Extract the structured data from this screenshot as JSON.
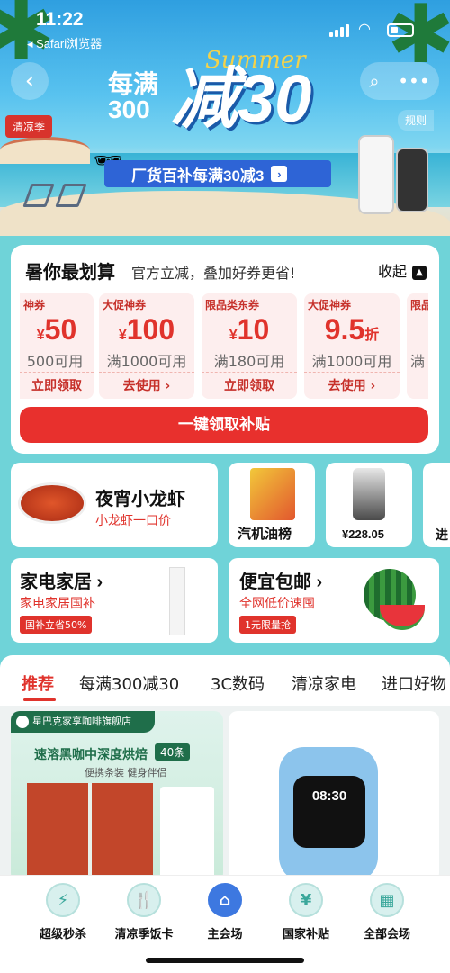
{
  "status": {
    "time": "11:22",
    "back_app": "◂ Safari浏览器"
  },
  "hero": {
    "summer": "Summer",
    "promo_prefix": "每满\n300",
    "promo_main": "减30",
    "season_tag": "清凉季",
    "rules": "规则",
    "banner": "厂货百补每满30减3",
    "banner_arrow": "›"
  },
  "coupon_panel": {
    "title": "暑你最划算",
    "subtitle": "官方立减，叠加好券更省!",
    "collapse": "收起",
    "coupons": [
      {
        "tag": "神券",
        "amount": "50",
        "prefix": "¥",
        "suffix": "",
        "cond": "500可用",
        "action": "立即领取"
      },
      {
        "tag": "大促神券",
        "amount": "100",
        "prefix": "¥",
        "suffix": "",
        "cond": "满1000可用",
        "action": "去使用 ›"
      },
      {
        "tag": "限品类东券",
        "amount": "10",
        "prefix": "¥",
        "suffix": "",
        "cond": "满180可用",
        "action": "立即领取"
      },
      {
        "tag": "大促神券",
        "amount": "9.5",
        "prefix": "",
        "suffix": "折",
        "cond": "满1000可用",
        "action": "去使用 ›"
      },
      {
        "tag": "限品",
        "amount": "",
        "prefix": "",
        "suffix": "",
        "cond": "满",
        "action": ""
      }
    ],
    "claim_all": "一键领取补贴"
  },
  "categories": {
    "crayfish": {
      "title": "夜宵小龙虾",
      "sub": "小龙虾一口价"
    },
    "oil": {
      "title": "汽机油榜"
    },
    "price": {
      "title": "¥228.05"
    },
    "more": {
      "title": "进"
    },
    "appliance": {
      "title": "家电家居 ›",
      "sub": "家电家居国补",
      "badge": "国补立省50%"
    },
    "cheap": {
      "title": "便宜包邮 ›",
      "sub": "全网低价速囤",
      "badge": "1元限量抢"
    }
  },
  "tabs": [
    "推荐",
    "每满300减30",
    "3C数码",
    "清凉家电",
    "进口好物"
  ],
  "feed": {
    "store": "星巴克家享咖啡旗舰店",
    "product_title": "速溶黑咖中深度烘焙",
    "count_badge": "40条",
    "product_sub": "便携条装 健身伴侣",
    "watch_time": "08:30"
  },
  "bottom_nav": [
    {
      "label": "超级秒杀",
      "icon": "⚡"
    },
    {
      "label": "清凉季饭卡",
      "icon": "🍴"
    },
    {
      "label": "主会场",
      "icon": "⌂"
    },
    {
      "label": "国家补贴",
      "icon": "¥"
    },
    {
      "label": "全部会场",
      "icon": "▦"
    }
  ]
}
